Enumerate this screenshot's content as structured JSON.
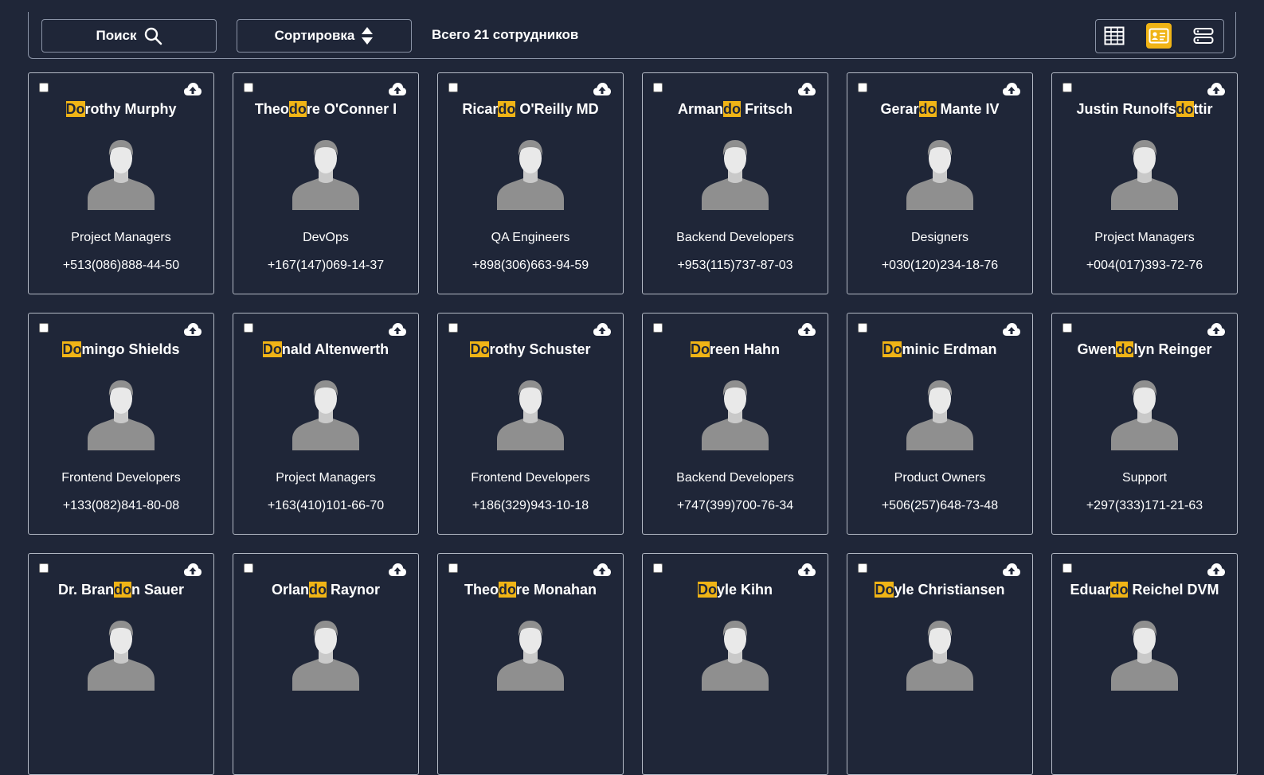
{
  "toolbar": {
    "search_label": "Поиск",
    "sort_label": "Сортировка",
    "total_text": "Всего 21 сотрудников",
    "views": [
      {
        "icon": "table-view-icon",
        "active": false
      },
      {
        "icon": "card-view-icon",
        "active": true
      },
      {
        "icon": "list-view-icon",
        "active": false
      }
    ],
    "accent_color": "#f0b416"
  },
  "employees": [
    {
      "name": [
        "",
        "Do",
        "rothy Murphy"
      ],
      "department": "Project Managers",
      "phone": "+513(086)888-44-50"
    },
    {
      "name": [
        "Theo",
        "do",
        "re O'Conner I"
      ],
      "department": "DevOps",
      "phone": "+167(147)069-14-37"
    },
    {
      "name": [
        "Ricar",
        "do",
        " O'Reilly MD"
      ],
      "department": "QA Engineers",
      "phone": "+898(306)663-94-59"
    },
    {
      "name": [
        "Arman",
        "do",
        " Fritsch"
      ],
      "department": "Backend Developers",
      "phone": "+953(115)737-87-03"
    },
    {
      "name": [
        "Gerar",
        "do",
        " Mante IV"
      ],
      "department": "Designers",
      "phone": "+030(120)234-18-76"
    },
    {
      "name": [
        "Justin Runolfs",
        "do",
        "ttir"
      ],
      "department": "Project Managers",
      "phone": "+004(017)393-72-76"
    },
    {
      "name": [
        "",
        "Do",
        "mingo Shields"
      ],
      "department": "Frontend Developers",
      "phone": "+133(082)841-80-08"
    },
    {
      "name": [
        "",
        "Do",
        "nald Altenwerth"
      ],
      "department": "Project Managers",
      "phone": "+163(410)101-66-70"
    },
    {
      "name": [
        "",
        "Do",
        "rothy Schuster"
      ],
      "department": "Frontend Developers",
      "phone": "+186(329)943-10-18"
    },
    {
      "name": [
        "",
        "Do",
        "reen Hahn"
      ],
      "department": "Backend Developers",
      "phone": "+747(399)700-76-34"
    },
    {
      "name": [
        "",
        "Do",
        "minic Erdman"
      ],
      "department": "Product Owners",
      "phone": "+506(257)648-73-48"
    },
    {
      "name": [
        "Gwen",
        "do",
        "lyn Reinger"
      ],
      "department": "Support",
      "phone": "+297(333)171-21-63"
    },
    {
      "name": [
        "Dr. Bran",
        "do",
        "n Sauer"
      ],
      "department": "",
      "phone": ""
    },
    {
      "name": [
        "Orlan",
        "do",
        " Raynor"
      ],
      "department": "",
      "phone": ""
    },
    {
      "name": [
        "Theo",
        "do",
        "re Monahan"
      ],
      "department": "",
      "phone": ""
    },
    {
      "name": [
        "",
        "Do",
        "yle Kihn"
      ],
      "department": "",
      "phone": ""
    },
    {
      "name": [
        "",
        "Do",
        "yle Christiansen"
      ],
      "department": "",
      "phone": ""
    },
    {
      "name": [
        "Eduar",
        "do",
        " Reichel DVM"
      ],
      "department": "",
      "phone": ""
    }
  ]
}
